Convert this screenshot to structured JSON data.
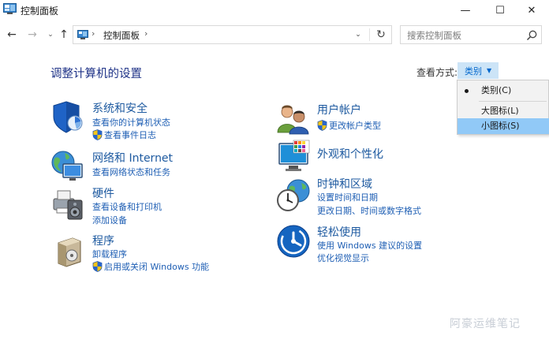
{
  "window": {
    "title": "控制面板",
    "minimize_glyph": "—",
    "maximize_glyph": "☐",
    "close_glyph": "✕"
  },
  "nav": {
    "back_glyph": "←",
    "forward_glyph": "→",
    "recent_glyph": "⌄",
    "up_glyph": "↑",
    "breadcrumb": [
      "控制面板"
    ],
    "address_dropdown_glyph": "⌄",
    "refresh_glyph": "↻"
  },
  "search": {
    "placeholder": "搜索控制面板"
  },
  "header": {
    "title": "调整计算机的设置",
    "view_by_label": "查看方式:",
    "view_by_value": "类别"
  },
  "view_menu": {
    "items": [
      {
        "label": "类别(C)",
        "selected": true
      },
      {
        "label": "大图标(L)",
        "selected": false
      },
      {
        "label": "小图标(S)",
        "selected": false,
        "highlighted": true
      }
    ]
  },
  "categories_left": [
    {
      "icon": "system-security-icon",
      "title": "系统和安全",
      "links": [
        {
          "label": "查看你的计算机状态",
          "shield": false
        },
        {
          "label": "查看事件日志",
          "shield": true
        }
      ]
    },
    {
      "icon": "network-internet-icon",
      "title": "网络和 Internet",
      "links": [
        {
          "label": "查看网络状态和任务",
          "shield": false
        }
      ]
    },
    {
      "icon": "hardware-sound-icon",
      "title": "硬件",
      "links": [
        {
          "label": "查看设备和打印机",
          "shield": false
        },
        {
          "label": "添加设备",
          "shield": false
        }
      ]
    },
    {
      "icon": "programs-icon",
      "title": "程序",
      "links": [
        {
          "label": "卸载程序",
          "shield": false
        },
        {
          "label": "启用或关闭 Windows 功能",
          "shield": true
        }
      ]
    }
  ],
  "categories_right": [
    {
      "icon": "user-accounts-icon",
      "title": "用户帐户",
      "links": [
        {
          "label": "更改帐户类型",
          "shield": true
        }
      ]
    },
    {
      "icon": "appearance-personalization-icon",
      "title": "外观和个性化",
      "links": []
    },
    {
      "icon": "clock-region-icon",
      "title": "时钟和区域",
      "links": [
        {
          "label": "设置时间和日期",
          "shield": false
        },
        {
          "label": "更改日期、时间或数字格式",
          "shield": false
        }
      ]
    },
    {
      "icon": "ease-of-access-icon",
      "title": "轻松使用",
      "links": [
        {
          "label": "使用 Windows 建议的设置",
          "shield": false
        },
        {
          "label": "优化视觉显示",
          "shield": false
        }
      ]
    }
  ],
  "watermark": "阿豪运维笔记",
  "colors": {
    "heading_blue": "#1e3287",
    "link_blue": "#1f5fb4",
    "menu_highlight": "#91c9f7",
    "viewby_bg": "#cce4f7"
  }
}
